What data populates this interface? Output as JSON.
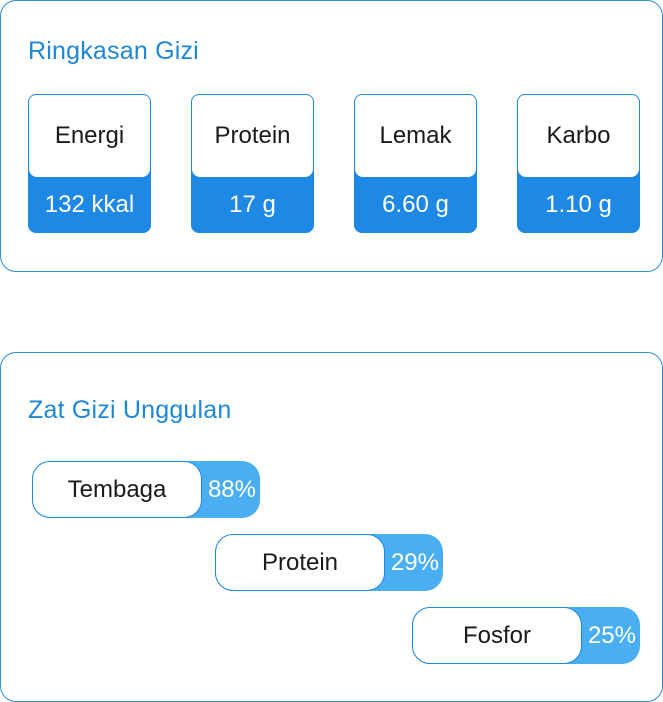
{
  "summary": {
    "title": "Ringkasan Gizi",
    "tiles": [
      {
        "label": "Energi",
        "value": "132 kkal"
      },
      {
        "label": "Protein",
        "value": "17 g"
      },
      {
        "label": "Lemak",
        "value": "6.60 g"
      },
      {
        "label": "Karbo",
        "value": "1.10 g"
      }
    ]
  },
  "highlights": {
    "title": "Zat Gizi Unggulan",
    "items": [
      {
        "name": "Tembaga",
        "percent": "88%"
      },
      {
        "name": "Protein",
        "percent": "29%"
      },
      {
        "name": "Fosfor",
        "percent": "25%"
      }
    ]
  },
  "colors": {
    "accent": "#1e88e5",
    "accent_light": "#49aef2",
    "title": "#1e88d6"
  }
}
